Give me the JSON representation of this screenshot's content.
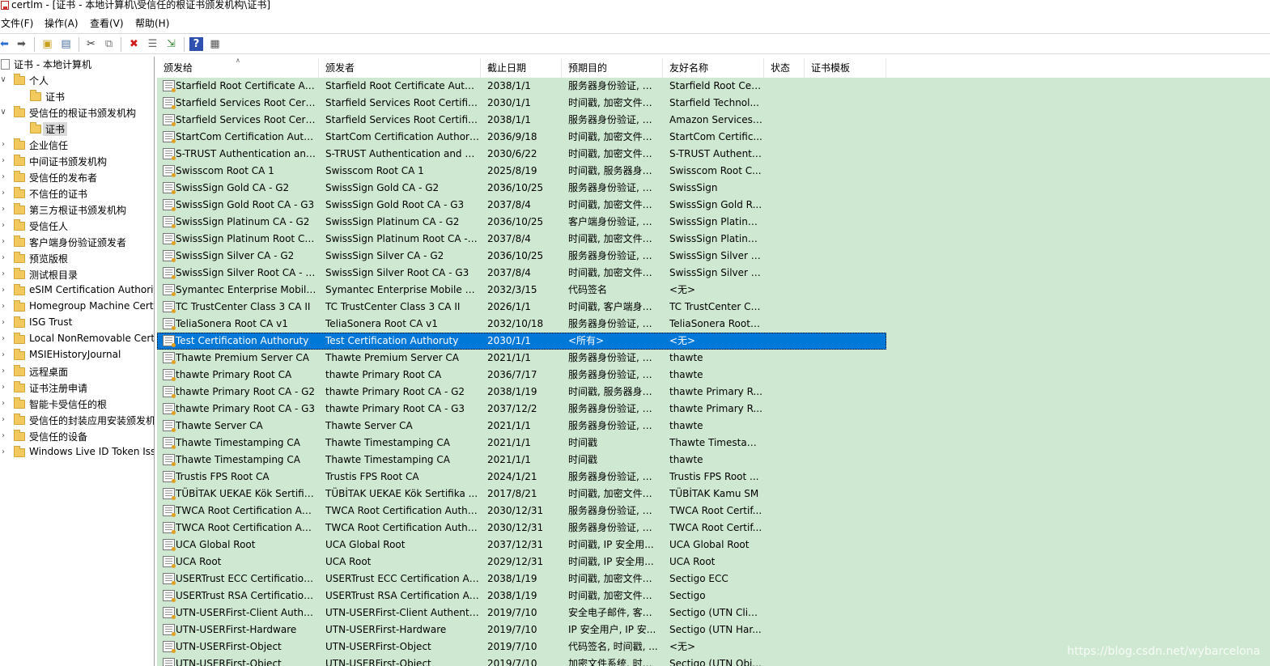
{
  "window": {
    "title": "certlm - [证书 - 本地计算机\\受信任的根证书颁发机构\\证书]"
  },
  "menu": [
    "文件(F)",
    "操作(A)",
    "查看(V)",
    "帮助(H)"
  ],
  "toolbar": {
    "icons": [
      "back-icon",
      "forward-icon",
      "up-folder-icon",
      "show-hide-tree-icon",
      "cut-icon",
      "copy-icon",
      "delete-icon",
      "properties-icon",
      "export-icon",
      "help-icon",
      "console-icon"
    ]
  },
  "tree": {
    "root": "证书 - 本地计算机",
    "items": [
      {
        "label": "个人",
        "level": 1,
        "expanded": true
      },
      {
        "label": "证书",
        "level": 2,
        "expanded": false
      },
      {
        "label": "受信任的根证书颁发机构",
        "level": 1,
        "expanded": true
      },
      {
        "label": "证书",
        "level": 2,
        "expanded": false,
        "selected": true
      },
      {
        "label": "企业信任",
        "level": 1,
        "expanded": false
      },
      {
        "label": "中间证书颁发机构",
        "level": 1,
        "expanded": false
      },
      {
        "label": "受信任的发布者",
        "level": 1,
        "expanded": false
      },
      {
        "label": "不信任的证书",
        "level": 1,
        "expanded": false
      },
      {
        "label": "第三方根证书颁发机构",
        "level": 1,
        "expanded": false
      },
      {
        "label": "受信任人",
        "level": 1,
        "expanded": false
      },
      {
        "label": "客户端身份验证颁发者",
        "level": 1,
        "expanded": false
      },
      {
        "label": "预览版根",
        "level": 1,
        "expanded": false
      },
      {
        "label": "测试根目录",
        "level": 1,
        "expanded": false
      },
      {
        "label": "eSIM Certification Authorit",
        "level": 1,
        "expanded": false
      },
      {
        "label": "Homegroup Machine Cert",
        "level": 1,
        "expanded": false
      },
      {
        "label": "ISG Trust",
        "level": 1,
        "expanded": false
      },
      {
        "label": "Local NonRemovable Cert",
        "level": 1,
        "expanded": false
      },
      {
        "label": "MSIEHistoryJournal",
        "level": 1,
        "expanded": false
      },
      {
        "label": "远程桌面",
        "level": 1,
        "expanded": false
      },
      {
        "label": "证书注册申请",
        "level": 1,
        "expanded": false
      },
      {
        "label": "智能卡受信任的根",
        "level": 1,
        "expanded": false
      },
      {
        "label": "受信任的封装应用安装颁发机",
        "level": 1,
        "expanded": false
      },
      {
        "label": "受信任的设备",
        "level": 1,
        "expanded": false
      },
      {
        "label": "Windows Live ID Token Iss",
        "level": 1,
        "expanded": false
      }
    ]
  },
  "list": {
    "columns": [
      "颁发给",
      "颁发者",
      "截止日期",
      "预期目的",
      "友好名称",
      "状态",
      "证书模板"
    ],
    "rows": [
      [
        "Starfield Root Certificate Aut...",
        "Starfield Root Certificate Auth...",
        "2038/1/1",
        "服务器身份验证, 客...",
        "Starfield Root Cer...",
        "",
        ""
      ],
      [
        "Starfield Services Root Certif...",
        "Starfield Services Root Certific...",
        "2030/1/1",
        "时间戳, 加密文件系...",
        "Starfield Technol...",
        "",
        ""
      ],
      [
        "Starfield Services Root Certif...",
        "Starfield Services Root Certific...",
        "2038/1/1",
        "服务器身份验证, 客...",
        "Amazon Services ...",
        "",
        ""
      ],
      [
        "StartCom Certification Autho...",
        "StartCom Certification Authority",
        "2036/9/18",
        "时间戳, 加密文件系...",
        "StartCom Certific...",
        "",
        ""
      ],
      [
        "S-TRUST Authentication and ...",
        "S-TRUST Authentication and E...",
        "2030/6/22",
        "时间戳, 加密文件系...",
        "S-TRUST Authenti...",
        "",
        ""
      ],
      [
        "Swisscom Root CA 1",
        "Swisscom Root CA 1",
        "2025/8/19",
        "时间戳, 服务器身份...",
        "Swisscom Root C...",
        "",
        ""
      ],
      [
        "SwissSign Gold CA - G2",
        "SwissSign Gold CA - G2",
        "2036/10/25",
        "服务器身份验证, 客...",
        "SwissSign",
        "",
        ""
      ],
      [
        "SwissSign Gold Root CA - G3",
        "SwissSign Gold Root CA - G3",
        "2037/8/4",
        "时间戳, 加密文件系...",
        "SwissSign Gold R...",
        "",
        ""
      ],
      [
        "SwissSign Platinum CA - G2",
        "SwissSign Platinum CA - G2",
        "2036/10/25",
        "客户端身份验证, 安...",
        "SwissSign Platinu...",
        "",
        ""
      ],
      [
        "SwissSign Platinum Root CA ...",
        "SwissSign Platinum Root CA - ...",
        "2037/8/4",
        "时间戳, 加密文件系...",
        "SwissSign Platinu...",
        "",
        ""
      ],
      [
        "SwissSign Silver CA - G2",
        "SwissSign Silver CA - G2",
        "2036/10/25",
        "服务器身份验证, 客...",
        "SwissSign Silver G...",
        "",
        ""
      ],
      [
        "SwissSign Silver Root CA - G3",
        "SwissSign Silver Root CA - G3",
        "2037/8/4",
        "时间戳, 加密文件系...",
        "SwissSign Silver R...",
        "",
        ""
      ],
      [
        "Symantec Enterprise Mobile ...",
        "Symantec Enterprise Mobile R...",
        "2032/3/15",
        "代码签名",
        "<无>",
        "",
        ""
      ],
      [
        "TC TrustCenter Class 3 CA II",
        "TC TrustCenter Class 3 CA II",
        "2026/1/1",
        "时间戳, 客户端身份...",
        "TC TrustCenter Cl...",
        "",
        ""
      ],
      [
        "TeliaSonera Root CA v1",
        "TeliaSonera Root CA v1",
        "2032/10/18",
        "服务器身份验证, 客...",
        "TeliaSonera Root ...",
        "",
        ""
      ],
      [
        "Test Certification Authoruty",
        "Test Certification Authoruty",
        "2030/1/1",
        "<所有>",
        "<无>",
        "",
        ""
      ],
      [
        "Thawte Premium Server CA",
        "Thawte Premium Server CA",
        "2021/1/1",
        "服务器身份验证, 代...",
        "thawte",
        "",
        ""
      ],
      [
        "thawte Primary Root CA",
        "thawte Primary Root CA",
        "2036/7/17",
        "服务器身份验证, 客...",
        "thawte",
        "",
        ""
      ],
      [
        "thawte Primary Root CA - G2",
        "thawte Primary Root CA - G2",
        "2038/1/19",
        "时间戳, 服务器身份...",
        "thawte Primary R...",
        "",
        ""
      ],
      [
        "thawte Primary Root CA - G3",
        "thawte Primary Root CA - G3",
        "2037/12/2",
        "服务器身份验证, 客...",
        "thawte Primary R...",
        "",
        ""
      ],
      [
        "Thawte Server CA",
        "Thawte Server CA",
        "2021/1/1",
        "服务器身份验证, 代...",
        "thawte",
        "",
        ""
      ],
      [
        "Thawte Timestamping CA",
        "Thawte Timestamping CA",
        "2021/1/1",
        "时间戳",
        "Thawte Timestam...",
        "",
        ""
      ],
      [
        "Thawte Timestamping CA",
        "Thawte Timestamping CA",
        "2021/1/1",
        "时间戳",
        "thawte",
        "",
        ""
      ],
      [
        "Trustis FPS Root CA",
        "Trustis FPS Root CA",
        "2024/1/21",
        "服务器身份验证, 客...",
        "Trustis FPS Root ...",
        "",
        ""
      ],
      [
        "TÜBİTAK UEKAE Kök Sertifik...",
        "TÜBİTAK UEKAE Kök Sertifika ...",
        "2017/8/21",
        "时间戳, 加密文件系...",
        "TÜBİTAK Kamu SM",
        "",
        ""
      ],
      [
        "TWCA Root Certification Aut...",
        "TWCA Root Certification Autho...",
        "2030/12/31",
        "服务器身份验证, 客...",
        "TWCA Root Certif...",
        "",
        ""
      ],
      [
        "TWCA Root Certification Aut...",
        "TWCA Root Certification Autho...",
        "2030/12/31",
        "服务器身份验证, 客...",
        "TWCA Root Certif...",
        "",
        ""
      ],
      [
        "UCA Global Root",
        "UCA Global Root",
        "2037/12/31",
        "时间戳, IP 安全用...",
        "UCA Global Root",
        "",
        ""
      ],
      [
        "UCA Root",
        "UCA Root",
        "2029/12/31",
        "时间戳, IP 安全用...",
        "UCA Root",
        "",
        ""
      ],
      [
        "USERTrust ECC Certification ...",
        "USERTrust ECC Certification Au...",
        "2038/1/19",
        "时间戳, 加密文件系...",
        "Sectigo ECC",
        "",
        ""
      ],
      [
        "USERTrust RSA Certification ...",
        "USERTrust RSA Certification Au...",
        "2038/1/19",
        "时间戳, 加密文件系...",
        "Sectigo",
        "",
        ""
      ],
      [
        "UTN-USERFirst-Client Authen...",
        "UTN-USERFirst-Client Authenti...",
        "2019/7/10",
        "安全电子邮件, 客户...",
        "Sectigo (UTN Clie...",
        "",
        ""
      ],
      [
        "UTN-USERFirst-Hardware",
        "UTN-USERFirst-Hardware",
        "2019/7/10",
        "IP 安全用户, IP 安...",
        "Sectigo (UTN Har...",
        "",
        ""
      ],
      [
        "UTN-USERFirst-Object",
        "UTN-USERFirst-Object",
        "2019/7/10",
        "代码签名, 时间戳, ...",
        "<无>",
        "",
        ""
      ],
      [
        "UTN-USERFirst-Object",
        "UTN-USERFirst-Object",
        "2019/7/10",
        "加密文件系统, 时间...",
        "Sectigo (UTN Obj...",
        "",
        ""
      ]
    ],
    "selected_index": 15
  },
  "watermark": "https://blog.csdn.net/wybarcelona",
  "colors": {
    "list_background": "#cfe8d1",
    "selection": "#0078d7",
    "folder": "#f2c95c"
  }
}
